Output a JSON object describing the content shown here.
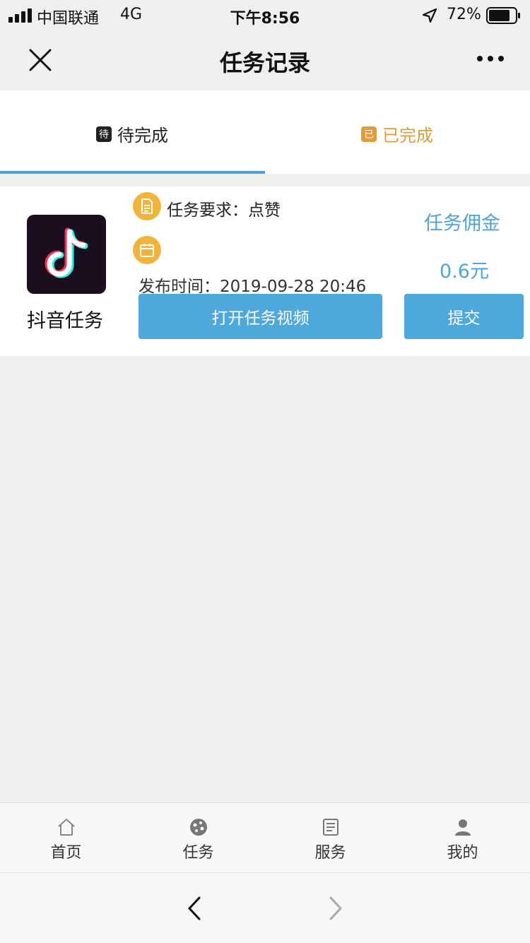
{
  "status_bar": {
    "carrier": "中国联通",
    "network": "4G",
    "time": "下午8:56",
    "battery": "72%",
    "icons": [
      "signal-icon",
      "location-arrow-icon",
      "battery-icon"
    ]
  },
  "nav": {
    "title": "任务记录",
    "icons": [
      "close-icon",
      "more-icon"
    ]
  },
  "tabs": [
    {
      "badge": "待",
      "label": "待完成",
      "active": true
    },
    {
      "badge": "已",
      "label": "已完成",
      "active": false
    }
  ],
  "task": {
    "app_name": "抖音任务",
    "app_icon": "tiktok-logo",
    "requirement": "任务要求：点赞",
    "publish_time": "发布时间：2019-09-28 20:46",
    "fee_label": "任务佣金",
    "fee_value": "0.6元",
    "open_button": "打开任务视频",
    "submit_button": "提交"
  },
  "bottom_nav": [
    {
      "label": "首页",
      "icon": "home-icon"
    },
    {
      "label": "任务",
      "icon": "task-icon"
    },
    {
      "label": "服务",
      "icon": "service-icon"
    },
    {
      "label": "我的",
      "icon": "user-icon"
    }
  ],
  "browser": {
    "icons": [
      "back-arrow-icon",
      "forward-arrow-icon"
    ]
  },
  "colors": {
    "accent": "#4fa3db",
    "orange": "#e39b3a",
    "badge_orange": "#f0b43a",
    "background": "#efefef"
  }
}
